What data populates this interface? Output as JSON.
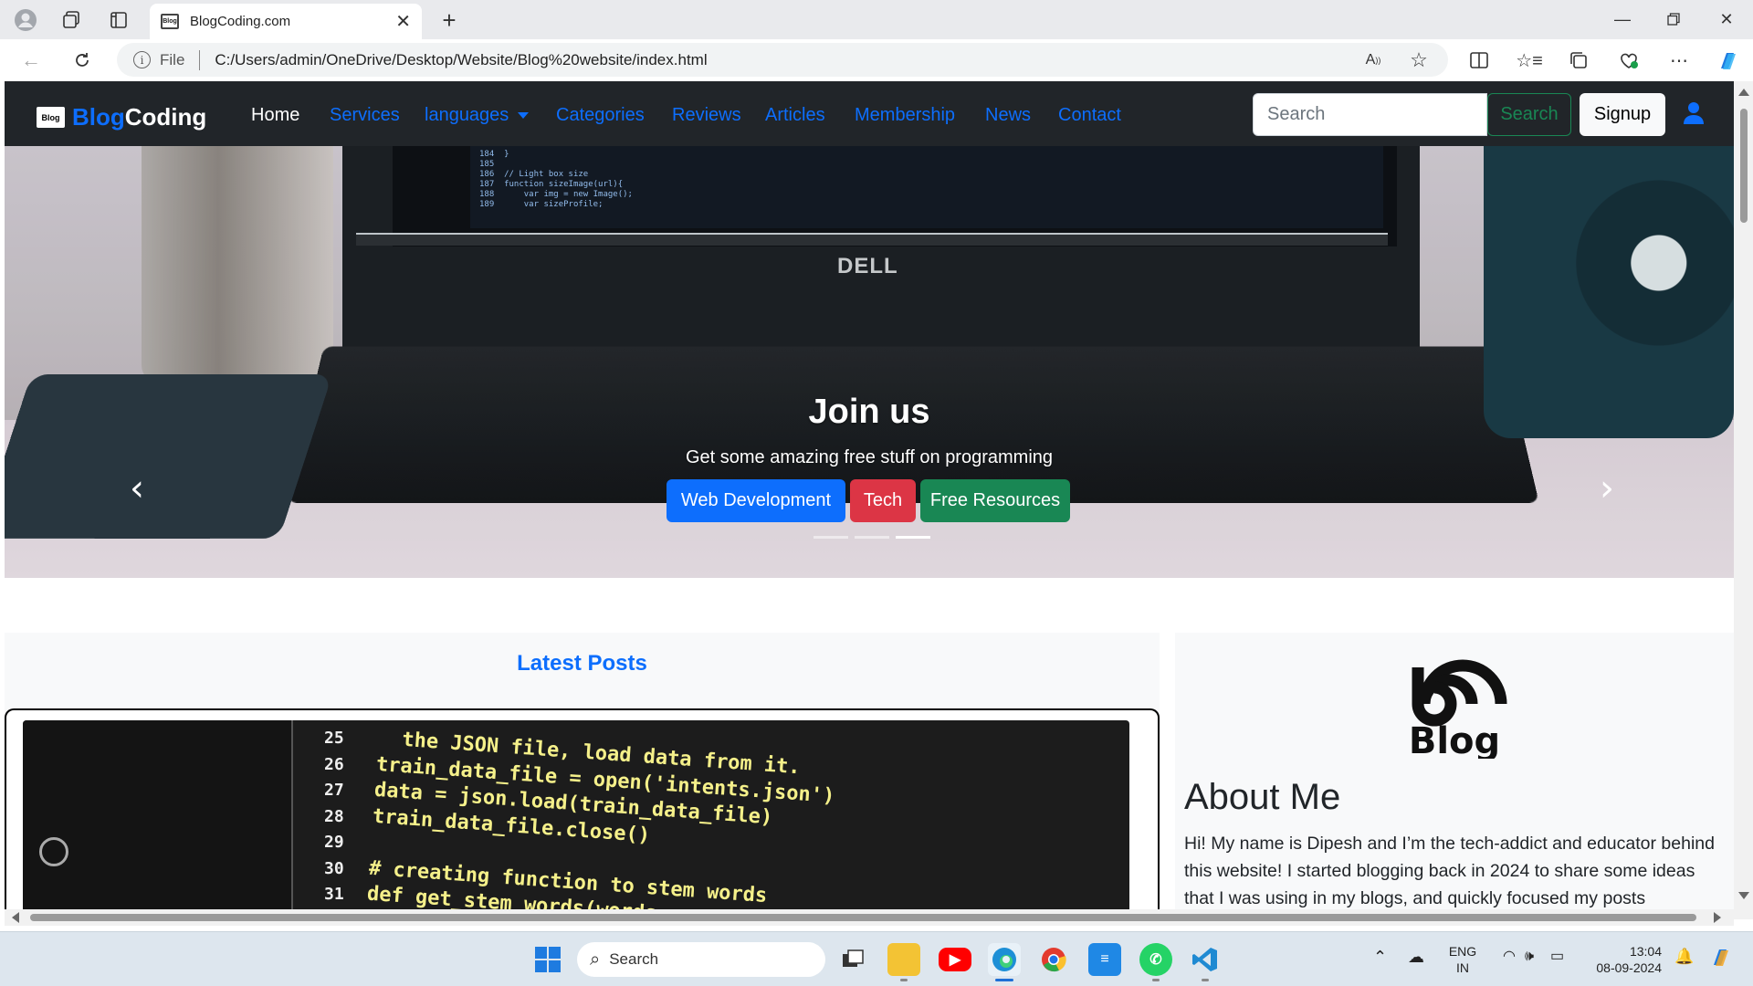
{
  "browser": {
    "tab_title": "BlogCoding.com",
    "favicon_text": "Blog",
    "url_scheme_label": "File",
    "url": "C:/Users/admin/OneDrive/Desktop/Website/Blog%20website/index.html"
  },
  "site": {
    "brand_logo_text": "Blog",
    "brand_part1": "Blog",
    "brand_part2": "Coding",
    "nav": [
      "Home",
      "Services",
      "languages",
      "Categories",
      "Reviews",
      "Articles",
      "Membership",
      "News",
      "Contact"
    ],
    "search_placeholder": "Search",
    "search_button": "Search",
    "signup_button": "Signup"
  },
  "hero": {
    "title": "Join us",
    "subtitle": "Get some amazing free stuff on programming",
    "buttons": [
      "Web Development",
      "Tech",
      "Free Resources"
    ],
    "prev_arrow": "‹",
    "next_arrow": "›",
    "dell_logo": "DELL",
    "screen_code": "184  }\n185\n186  // Light box size\n187  function sizeImage(url){\n188      var img = new Image();\n189      var sizeProfile;"
  },
  "latest": {
    "title": "Latest Posts",
    "line_numbers": [
      "25",
      "26",
      "27",
      "28",
      "29",
      "30",
      "31"
    ],
    "code": "  the JSON file, load data from it.\ntrain_data_file = open('intents.json')\ndata = json.load(train_data_file)\ntrain_data_file.close()\n\n# creating function to stem words\ndef get_stem_words(words,"
  },
  "about": {
    "logo_text": "Blog",
    "title": "About Me",
    "text": "Hi! My name is Dipesh and I’m the tech-addict and educator behind this website! I started blogging back in 2024 to share some ideas that I was using in my blogs, and quickly focused my posts"
  },
  "taskbar": {
    "search_placeholder": "Search",
    "lang_line1": "ENG",
    "lang_line2": "IN",
    "time": "13:04",
    "date": "08-09-2024"
  },
  "colors": {
    "primary": "#0d6efd",
    "danger": "#dc3545",
    "success": "#198754",
    "navbar_bg": "#212529"
  }
}
